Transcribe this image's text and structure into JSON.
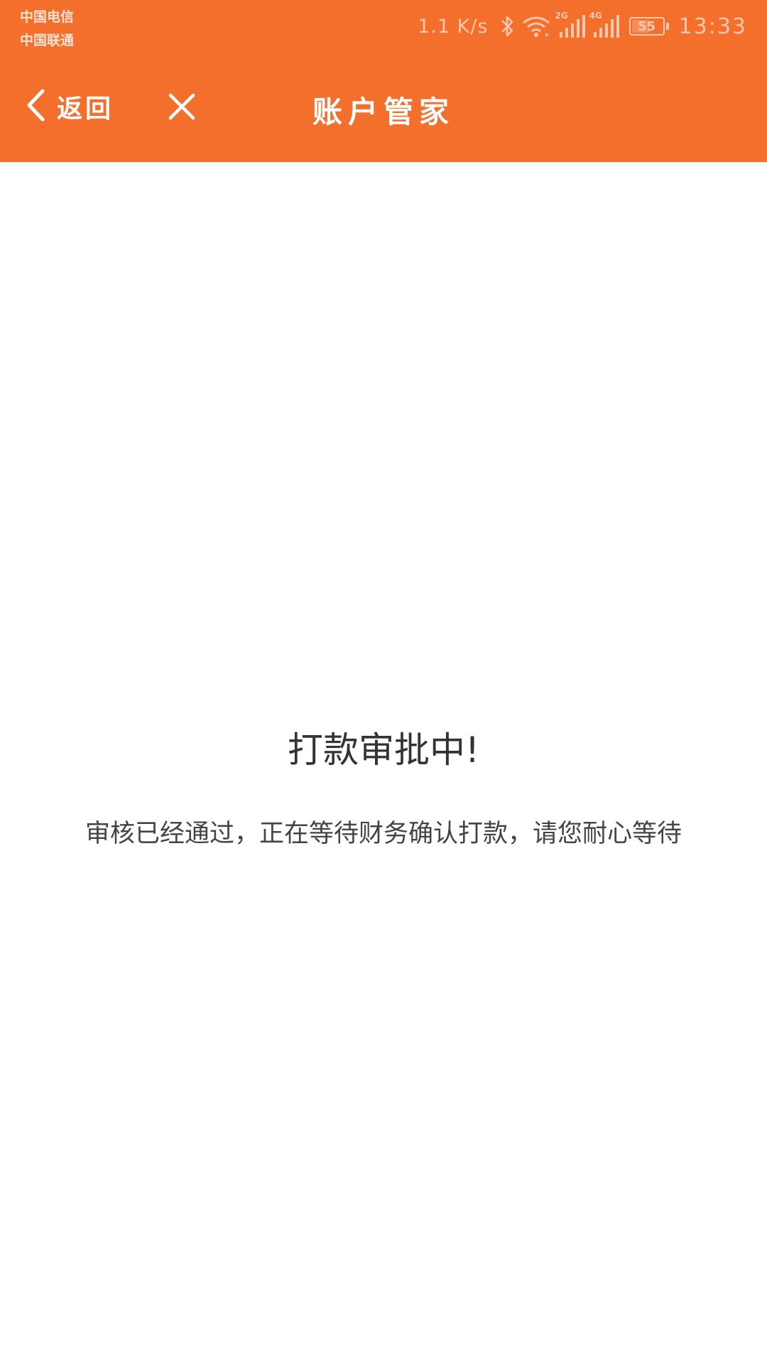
{
  "status_bar": {
    "carrier1": "中国电信",
    "carrier2": "中国联通",
    "net_speed": "1.1 K/s",
    "sim1_type": "2G",
    "sim2_type": "4G",
    "battery_level": "55",
    "time": "13:33",
    "icons": [
      "bluetooth-icon",
      "wifi-icon",
      "signal-icon",
      "battery-icon"
    ]
  },
  "nav": {
    "back_label": "返回",
    "title": "账户管家",
    "icons": [
      "back-chevron-icon",
      "close-icon"
    ]
  },
  "content": {
    "title": "打款审批中!",
    "description": "审核已经通过，正在等待财务确认打款，请您耐心等待"
  },
  "colors": {
    "accent": "#f46e2c",
    "background": "#ffffff",
    "text": "#333333"
  }
}
